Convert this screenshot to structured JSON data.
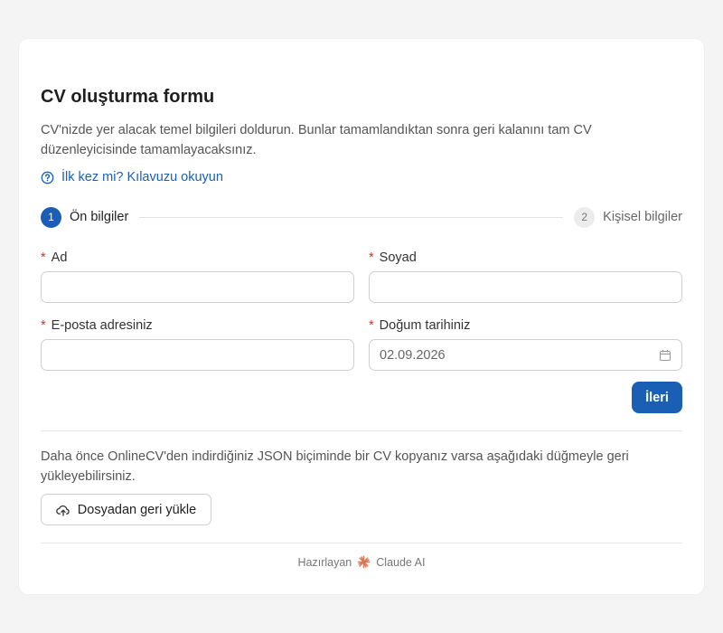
{
  "form": {
    "title": "CV oluşturma formu",
    "description": "CV'nizde yer alacak temel bilgileri doldurun. Bunlar tamamlandıktan sonra geri kalanını tam CV düzenleyicisinde tamamlayacaksınız.",
    "guide_link": "İlk kez mi? Kılavuzu okuyun"
  },
  "steps": [
    {
      "number": "1",
      "label": "Ön bilgiler",
      "active": true
    },
    {
      "number": "2",
      "label": "Kişisel bilgiler",
      "active": false
    }
  ],
  "fields": {
    "required_marker": "*",
    "first_name": {
      "label": "Ad",
      "value": ""
    },
    "last_name": {
      "label": "Soyad",
      "value": ""
    },
    "email": {
      "label": "E-posta adresiniz",
      "value": ""
    },
    "birth_date": {
      "label": "Doğum tarihiniz",
      "value": "02.09.2026",
      "icon": "calendar-icon"
    }
  },
  "actions": {
    "next_label": "İleri"
  },
  "restore": {
    "text": "Daha önce OnlineCV'den indirdiğiniz JSON biçiminde bir CV kopyanız varsa aşağıdaki düğmeyle geri yükleyebilirsiniz.",
    "button_label": "Dosyadan geri yükle",
    "button_icon": "cloud-upload-icon"
  },
  "footer": {
    "prefix": "Hazırlayan",
    "brand": "Claude AI",
    "brand_icon": "claude-sparkle-icon"
  },
  "colors": {
    "accent": "#1a5fb4",
    "required": "#c0392b",
    "brand": "#d97757",
    "background": "#f4f4f4",
    "card": "#ffffff"
  }
}
